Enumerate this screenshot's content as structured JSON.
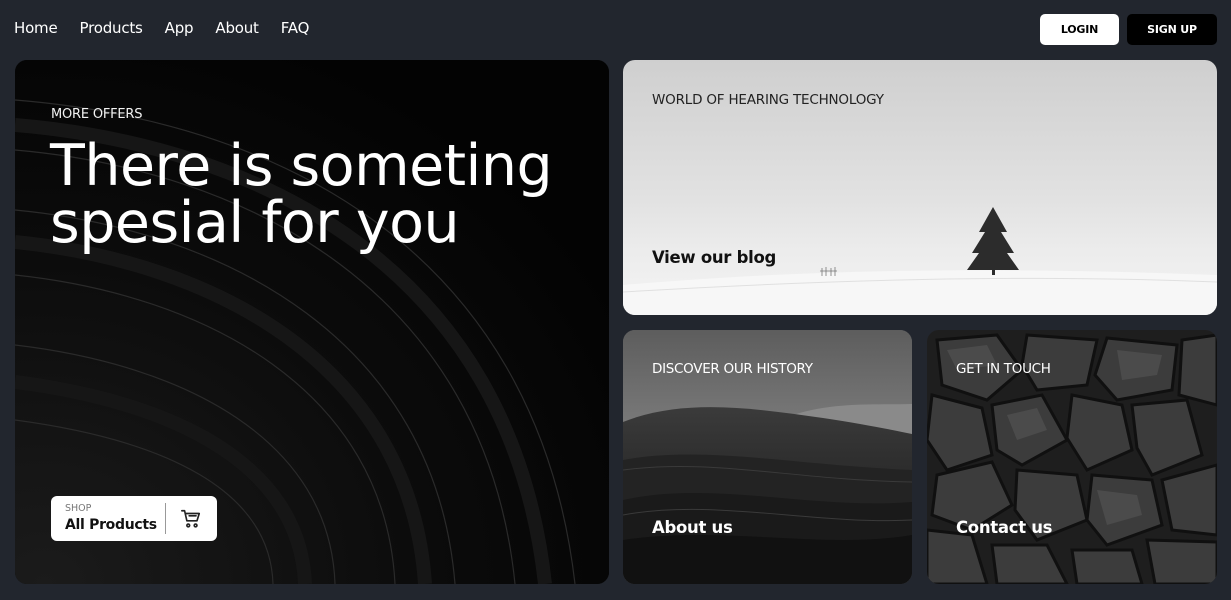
{
  "nav": {
    "links": [
      "Home",
      "Products",
      "App",
      "About",
      "FAQ"
    ],
    "login_label": "LOGIN",
    "signup_label": "SIGN UP"
  },
  "hero": {
    "eyebrow": "MORE OFFERS",
    "title_line1": "There is someting",
    "title_line2": "spesial for you",
    "shop_small": "SHOP",
    "shop_label": "All Products",
    "cart_icon": "cart-icon"
  },
  "blog_card": {
    "eyebrow": "WORLD OF HEARING TECHNOLOGY",
    "link": "View our blog"
  },
  "history_card": {
    "eyebrow": "DISCOVER OUR HISTORY",
    "link": "About us"
  },
  "contact_card": {
    "eyebrow": "GET IN TOUCH",
    "link": "Contact us"
  },
  "colors": {
    "page_bg": "#22262e",
    "hero_bg": "#050505",
    "login_bg": "#ffffff",
    "signup_bg": "#000000"
  }
}
